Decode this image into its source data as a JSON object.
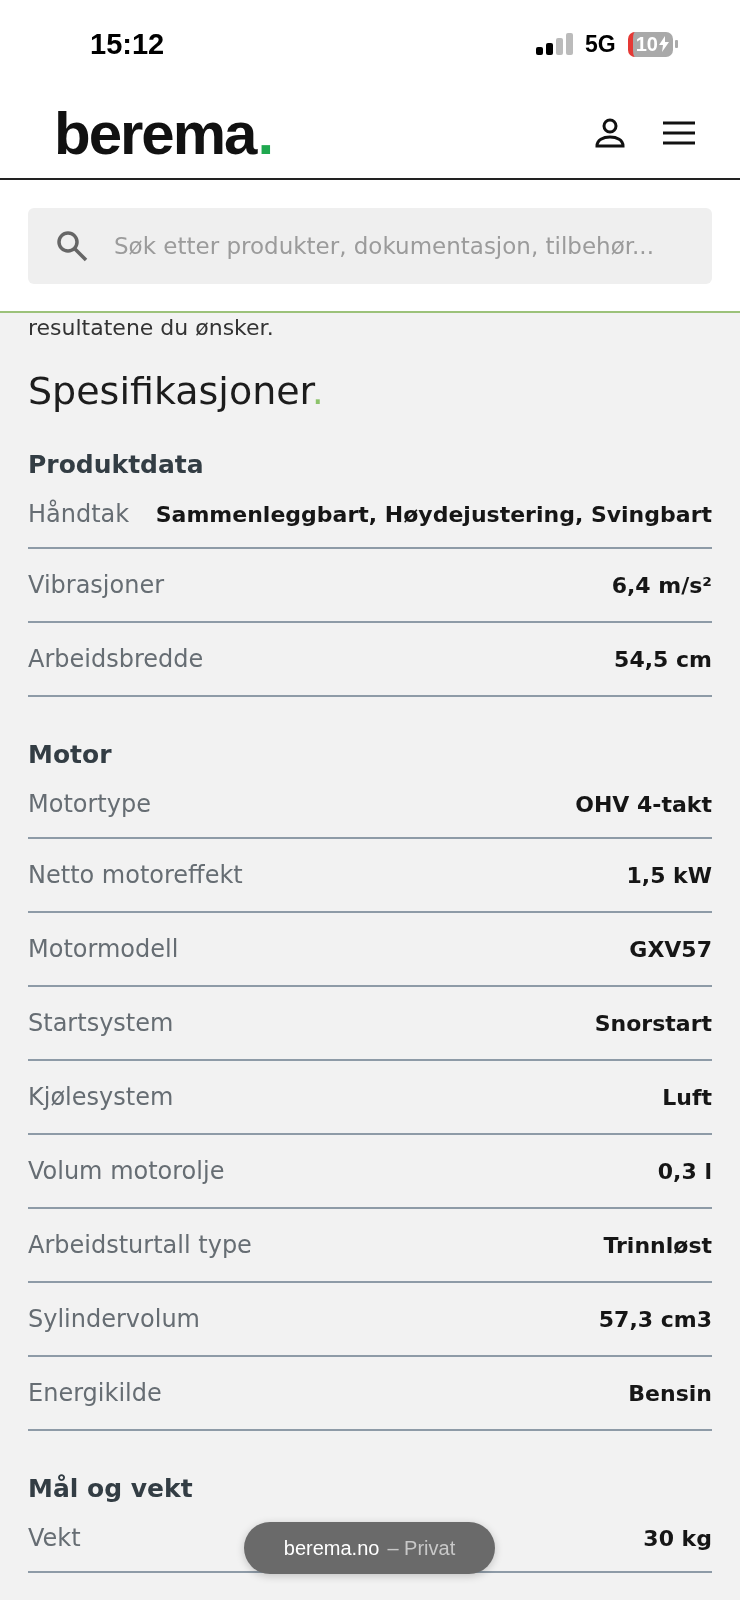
{
  "status_bar": {
    "time": "15:12",
    "network": "5G",
    "battery": "10"
  },
  "header": {
    "logo": "berema",
    "logo_dot": "."
  },
  "search": {
    "placeholder": "Søk etter produkter, dokumentasjon, tilbehør..."
  },
  "cut_text": "resultatene du ønsker.",
  "heading": {
    "text": "Spesifikasjoner",
    "dot": "."
  },
  "sections": [
    {
      "title": "Produktdata",
      "rows": [
        {
          "label": "Håndtak",
          "value": "Sammenleggbart, Høydejustering, Svingbart"
        },
        {
          "label": "Vibrasjoner",
          "value": "6,4 m/s²"
        },
        {
          "label": "Arbeidsbredde",
          "value": "54,5 cm"
        }
      ]
    },
    {
      "title": "Motor",
      "rows": [
        {
          "label": "Motortype",
          "value": "OHV 4-takt"
        },
        {
          "label": "Netto motoreffekt",
          "value": "1,5 kW"
        },
        {
          "label": "Motormodell",
          "value": "GXV57"
        },
        {
          "label": "Startsystem",
          "value": "Snorstart"
        },
        {
          "label": "Kjølesystem",
          "value": "Luft"
        },
        {
          "label": "Volum motorolje",
          "value": "0,3 l"
        },
        {
          "label": "Arbeidsturtall type",
          "value": "Trinnløst"
        },
        {
          "label": "Sylindervolum",
          "value": "57,3 cm3"
        },
        {
          "label": "Energikilde",
          "value": "Bensin"
        }
      ]
    },
    {
      "title": "Mål og vekt",
      "rows": [
        {
          "label": "Vekt",
          "value": "30 kg"
        }
      ]
    }
  ],
  "browser_pill": {
    "domain": "berema.no",
    "mode": "– Privat"
  }
}
